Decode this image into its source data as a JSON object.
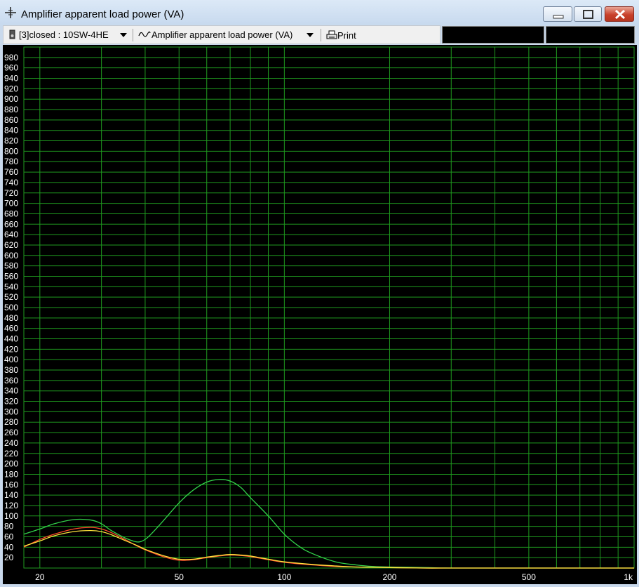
{
  "window": {
    "title": "Amplifier apparent load power (VA)",
    "icon": "crosshair-icon"
  },
  "toolbar": {
    "driver_select": "[3]closed : 10SW-4HE",
    "chart_select": "Amplifier apparent load power (VA)",
    "print_label": "Print"
  },
  "colors": {
    "background": "#000000",
    "grid": "#1f9a1f",
    "axis_text": "#ffffff",
    "series_green": "#33d24a",
    "series_red": "#ff4a2a",
    "series_yellow": "#ffe43c"
  },
  "chart_data": {
    "type": "line",
    "xscale": "log",
    "xlim": [
      18,
      1000
    ],
    "ylim": [
      0,
      1000
    ],
    "yticks": [
      20,
      40,
      60,
      80,
      100,
      120,
      140,
      160,
      180,
      200,
      220,
      240,
      260,
      280,
      300,
      320,
      340,
      360,
      380,
      400,
      420,
      440,
      460,
      480,
      500,
      520,
      540,
      560,
      580,
      600,
      620,
      640,
      660,
      680,
      700,
      720,
      740,
      760,
      780,
      800,
      820,
      840,
      860,
      880,
      900,
      920,
      940,
      960,
      980
    ],
    "xticks": [
      {
        "value": 20,
        "label": "20"
      },
      {
        "value": 50,
        "label": "50"
      },
      {
        "value": 100,
        "label": "100"
      },
      {
        "value": 200,
        "label": "200"
      },
      {
        "value": 500,
        "label": "500"
      },
      {
        "value": 1000,
        "label": "1k"
      }
    ],
    "grid": true,
    "series": [
      {
        "color": "#33d24a",
        "x": [
          18,
          20,
          22,
          25,
          28,
          30,
          32,
          35,
          38,
          40,
          42,
          45,
          50,
          55,
          60,
          65,
          70,
          75,
          80,
          90,
          100,
          110,
          120,
          140,
          160,
          180,
          200,
          250,
          300,
          400,
          500,
          700,
          1000
        ],
        "y": [
          65,
          75,
          85,
          93,
          92,
          85,
          72,
          58,
          50,
          55,
          68,
          90,
          125,
          150,
          165,
          170,
          167,
          155,
          135,
          100,
          65,
          42,
          28,
          12,
          6,
          3,
          2,
          1,
          0,
          0,
          0,
          0,
          0
        ]
      },
      {
        "color": "#ff4a2a",
        "x": [
          18,
          20,
          22,
          25,
          28,
          30,
          32,
          35,
          38,
          40,
          45,
          50,
          55,
          60,
          65,
          70,
          75,
          80,
          90,
          100,
          120,
          140,
          160,
          200,
          250,
          300,
          500,
          1000
        ],
        "y": [
          40,
          55,
          65,
          75,
          78,
          75,
          68,
          55,
          42,
          35,
          22,
          15,
          16,
          20,
          23,
          25,
          24,
          22,
          16,
          11,
          6,
          3,
          2,
          1,
          0,
          0,
          0,
          0
        ]
      },
      {
        "color": "#ffe43c",
        "x": [
          18,
          20,
          22,
          25,
          28,
          30,
          32,
          35,
          38,
          40,
          45,
          50,
          55,
          60,
          65,
          70,
          75,
          80,
          90,
          100,
          120,
          140,
          160,
          200,
          250,
          300,
          500,
          1000
        ],
        "y": [
          42,
          52,
          62,
          70,
          72,
          70,
          64,
          53,
          43,
          36,
          24,
          17,
          17,
          21,
          24,
          26,
          25,
          23,
          17,
          12,
          7,
          4,
          2,
          1,
          0,
          0,
          0,
          0
        ]
      }
    ]
  }
}
